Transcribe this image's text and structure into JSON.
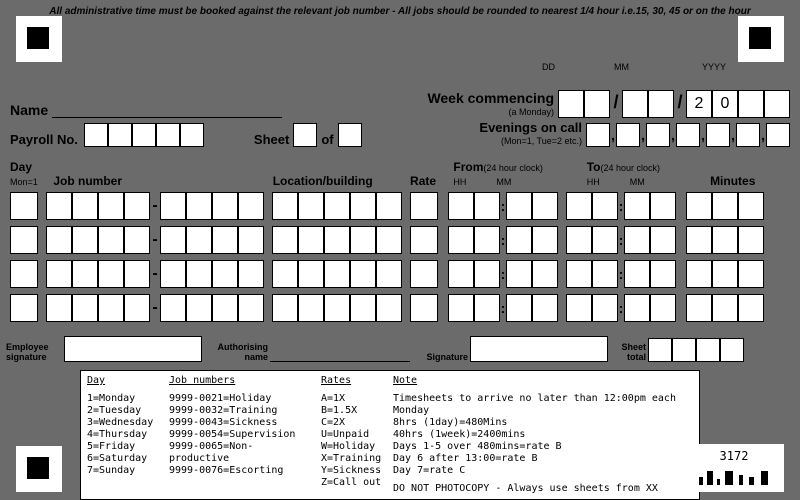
{
  "meta": {
    "top_note": "All administrative time must be booked against the relevant job number - All jobs should be rounded to nearest 1/4 hour i.e.15, 30, 45 or on the hour"
  },
  "labels": {
    "name": "Name",
    "week_commencing": "Week commencing",
    "a_monday": "(a Monday)",
    "payroll_no": "Payroll No.",
    "sheet": "Sheet",
    "of": "of",
    "evenings_on_call": "Evenings on call",
    "evenings_hint": "(Mon=1, Tue=2 etc.)",
    "day": "Day",
    "mon1": "Mon=1",
    "job_number": "Job number",
    "location": "Location/building",
    "rate": "Rate",
    "from": "From",
    "to": "To",
    "clock24": "(24 hour clock)",
    "minutes": "Minutes",
    "hh": "HH",
    "mm": "MM",
    "dd": "DD",
    "yyyy": "YYYY",
    "employee_signature": "Employee signature",
    "authorising_name": "Authorising name",
    "signature": "Signature",
    "sheet_total": "Sheet total"
  },
  "prefill": {
    "year": [
      "2",
      "0"
    ]
  },
  "legend": {
    "cols": [
      "Day",
      "Job numbers",
      "Rates",
      "Note"
    ],
    "days": [
      "1=Monday",
      "2=Tuesday",
      "3=Wednesday",
      "4=Thursday",
      "5=Friday",
      "6=Saturday",
      "7=Sunday"
    ],
    "jobs": [
      "9999-0021=Holiday",
      "9999-0032=Training",
      "9999-0043=Sickness",
      "9999-0054=Supervision",
      "9999-0065=Non-productive",
      "9999-0076=Escorting"
    ],
    "rates": [
      "A=1X",
      "B=1.5X",
      "C=2X",
      "U=Unpaid",
      "W=Holiday",
      "X=Training",
      "Y=Sickness",
      "Z=Call out"
    ],
    "notes": [
      "Timesheets to arrive no later than 12:00pm each Monday",
      "8hrs (1day)=480Mins",
      "40hrs (1week)=2400mins",
      "Days 1-5 over 480mins=rate B",
      "Day 6 after 13:00=rate B",
      "Day 7=rate C",
      "DO NOT PHOTOCOPY - Always use sheets from XX"
    ]
  },
  "barcode": {
    "number": "3172"
  }
}
